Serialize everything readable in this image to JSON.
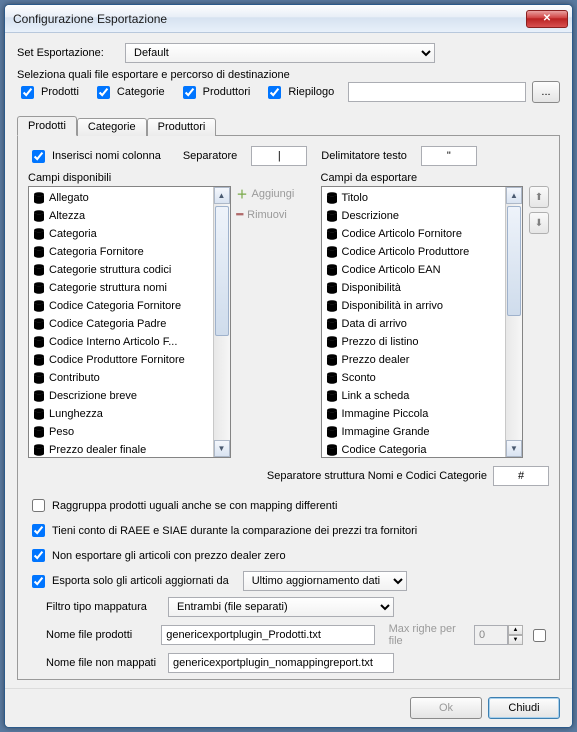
{
  "window": {
    "title": "Configurazione Esportazione"
  },
  "setExport": {
    "label": "Set Esportazione:",
    "value": "Default"
  },
  "selectFiles": {
    "label": "Seleziona quali file esportare e percorso di destinazione",
    "prodotti": "Prodotti",
    "categorie": "Categorie",
    "produttori": "Produttori",
    "riepilogo": "Riepilogo",
    "browse": "..."
  },
  "tabs": {
    "prodotti": "Prodotti",
    "categorie": "Categorie",
    "produttori": "Produttori"
  },
  "colRow": {
    "insert": "Inserisci nomi colonna",
    "sepLabel": "Separatore",
    "sepValue": "|",
    "delimLabel": "Delimitatore testo",
    "delimValue": "\""
  },
  "lists": {
    "availTitle": "Campi disponibili",
    "exportTitle": "Campi da esportare",
    "add": "Aggiungi",
    "remove": "Rimuovi",
    "available": [
      "Allegato",
      "Altezza",
      "Categoria",
      "Categoria Fornitore",
      "Categorie struttura codici",
      "Categorie struttura nomi",
      "Codice Categoria Fornitore",
      "Codice Categoria Padre",
      "Codice Interno Articolo F...",
      "Codice Produttore Fornitore",
      "Contributo",
      "Descrizione breve",
      "Lunghezza",
      "Peso",
      "Prezzo dealer finale"
    ],
    "toExport": [
      "Titolo",
      "Descrizione",
      "Codice Articolo Fornitore",
      "Codice Articolo Produttore",
      "Codice Articolo EAN",
      "Disponibilità",
      "Disponibilità in arrivo",
      "Data di arrivo",
      "Prezzo di listino",
      "Prezzo dealer",
      "Sconto",
      "Link a scheda",
      "Immagine Piccola",
      "Immagine Grande",
      "Codice Categoria"
    ]
  },
  "sepStruct": {
    "label": "Separatore struttura Nomi e Codici Categorie",
    "value": "#"
  },
  "opts": {
    "group": "Raggruppa prodotti uguali anche se con mapping differenti",
    "raee": "Tieni conto di RAEE e SIAE durante la comparazione dei prezzi tra fornitori",
    "zero": "Non esportare gli articoli con prezzo dealer zero",
    "updated": "Esporta solo gli articoli aggiornati da",
    "updatedVal": "Ultimo aggiornamento dati",
    "mapLabel": "Filtro tipo mappatura",
    "mapVal": "Entrambi (file separati)",
    "fileProdLabel": "Nome file prodotti",
    "fileProdVal": "genericexportplugin_Prodotti.txt",
    "maxRowsLabel": "Max righe per file",
    "maxRowsVal": "0",
    "fileUnmapLabel": "Nome file non mappati",
    "fileUnmapVal": "genericexportplugin_nomappingreport.txt"
  },
  "footer": {
    "ok": "Ok",
    "close": "Chiudi"
  }
}
